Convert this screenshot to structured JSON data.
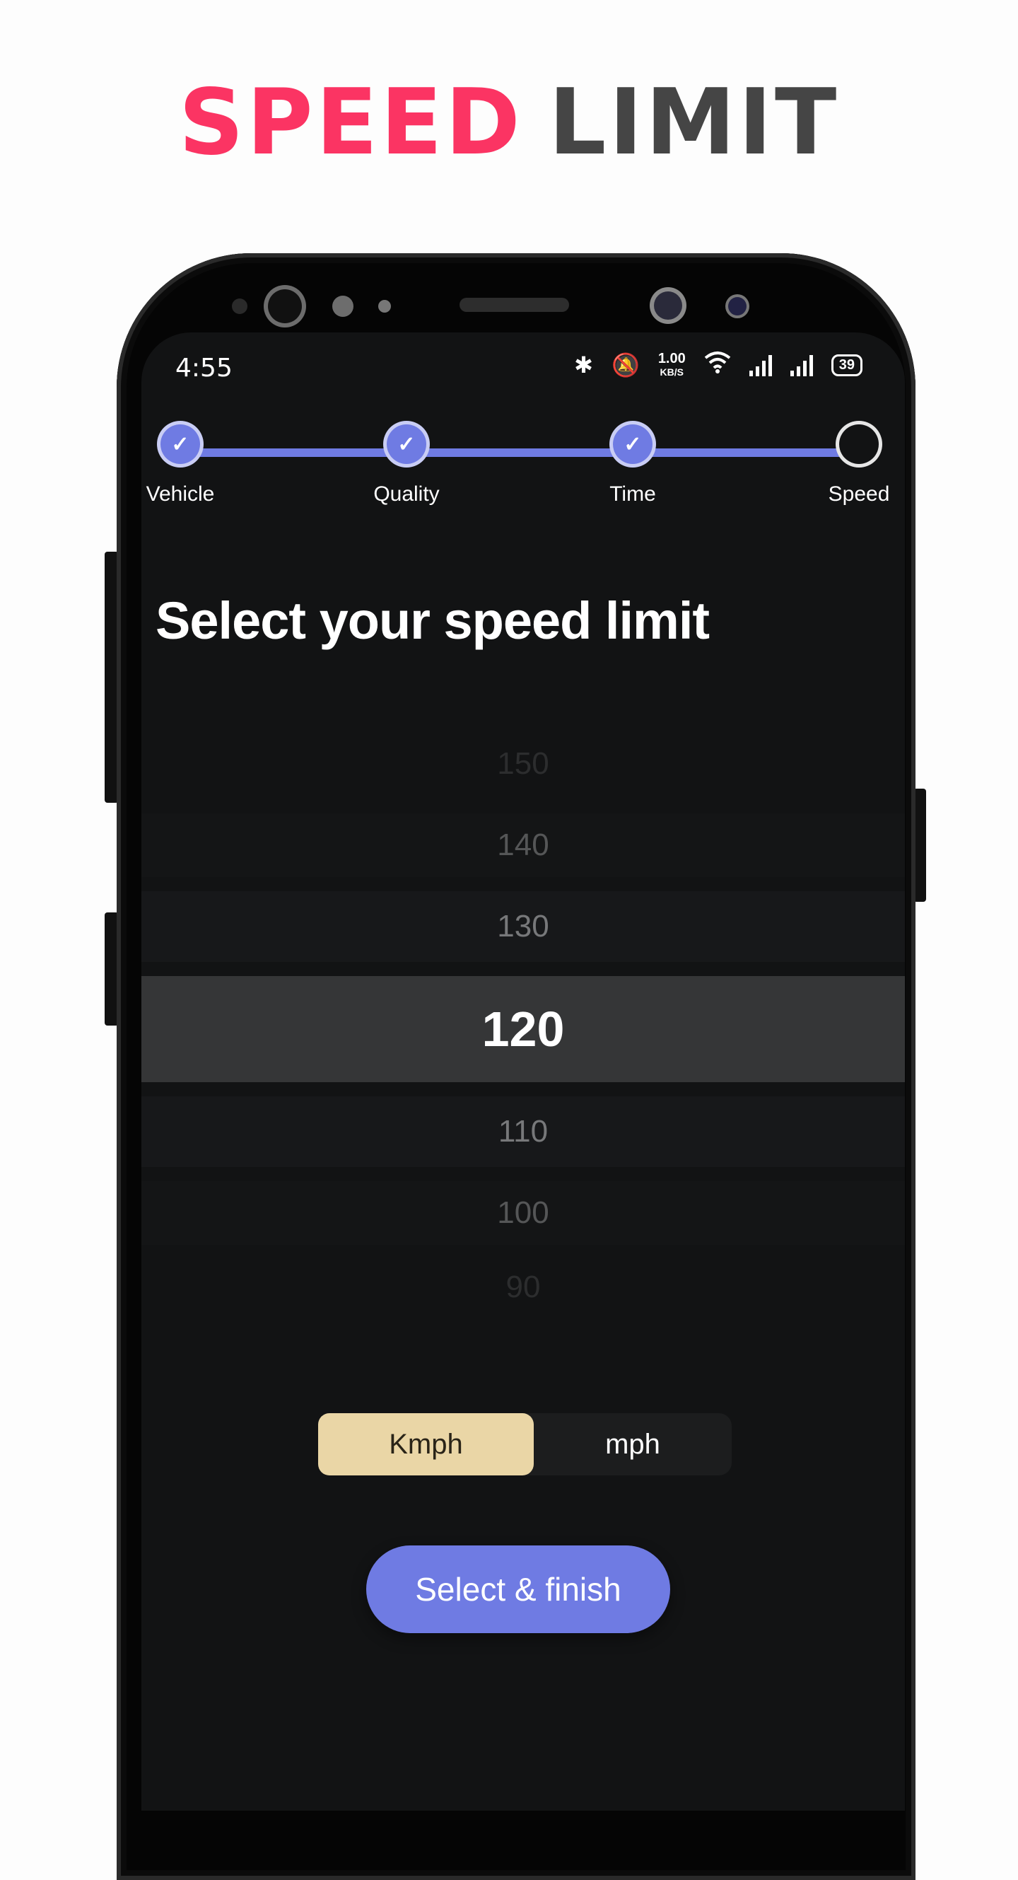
{
  "headline": {
    "word1": "SPEED",
    "word2": "LIMIT",
    "colors": {
      "word1": "#fb3463",
      "word2": "#454545"
    }
  },
  "status_bar": {
    "time": "4:55",
    "net_speed": "1.00",
    "net_unit": "KB/S",
    "battery": "39",
    "icons": [
      "bluetooth-icon",
      "mute-icon",
      "wifi-icon",
      "signal-icon",
      "signal-icon",
      "battery-icon"
    ]
  },
  "stepper": {
    "accent": "#6f7be3",
    "steps": [
      {
        "label": "Vehicle",
        "done": true
      },
      {
        "label": "Quality",
        "done": true
      },
      {
        "label": "Time",
        "done": true
      },
      {
        "label": "Speed",
        "done": false
      }
    ]
  },
  "page": {
    "title": "Select your speed limit"
  },
  "picker": {
    "values": [
      "150",
      "140",
      "130",
      "120",
      "110",
      "100",
      "90"
    ],
    "selected": "120"
  },
  "units": {
    "options": [
      "Kmph",
      "mph"
    ],
    "selected": "Kmph"
  },
  "actions": {
    "finish_label": "Select & finish"
  }
}
